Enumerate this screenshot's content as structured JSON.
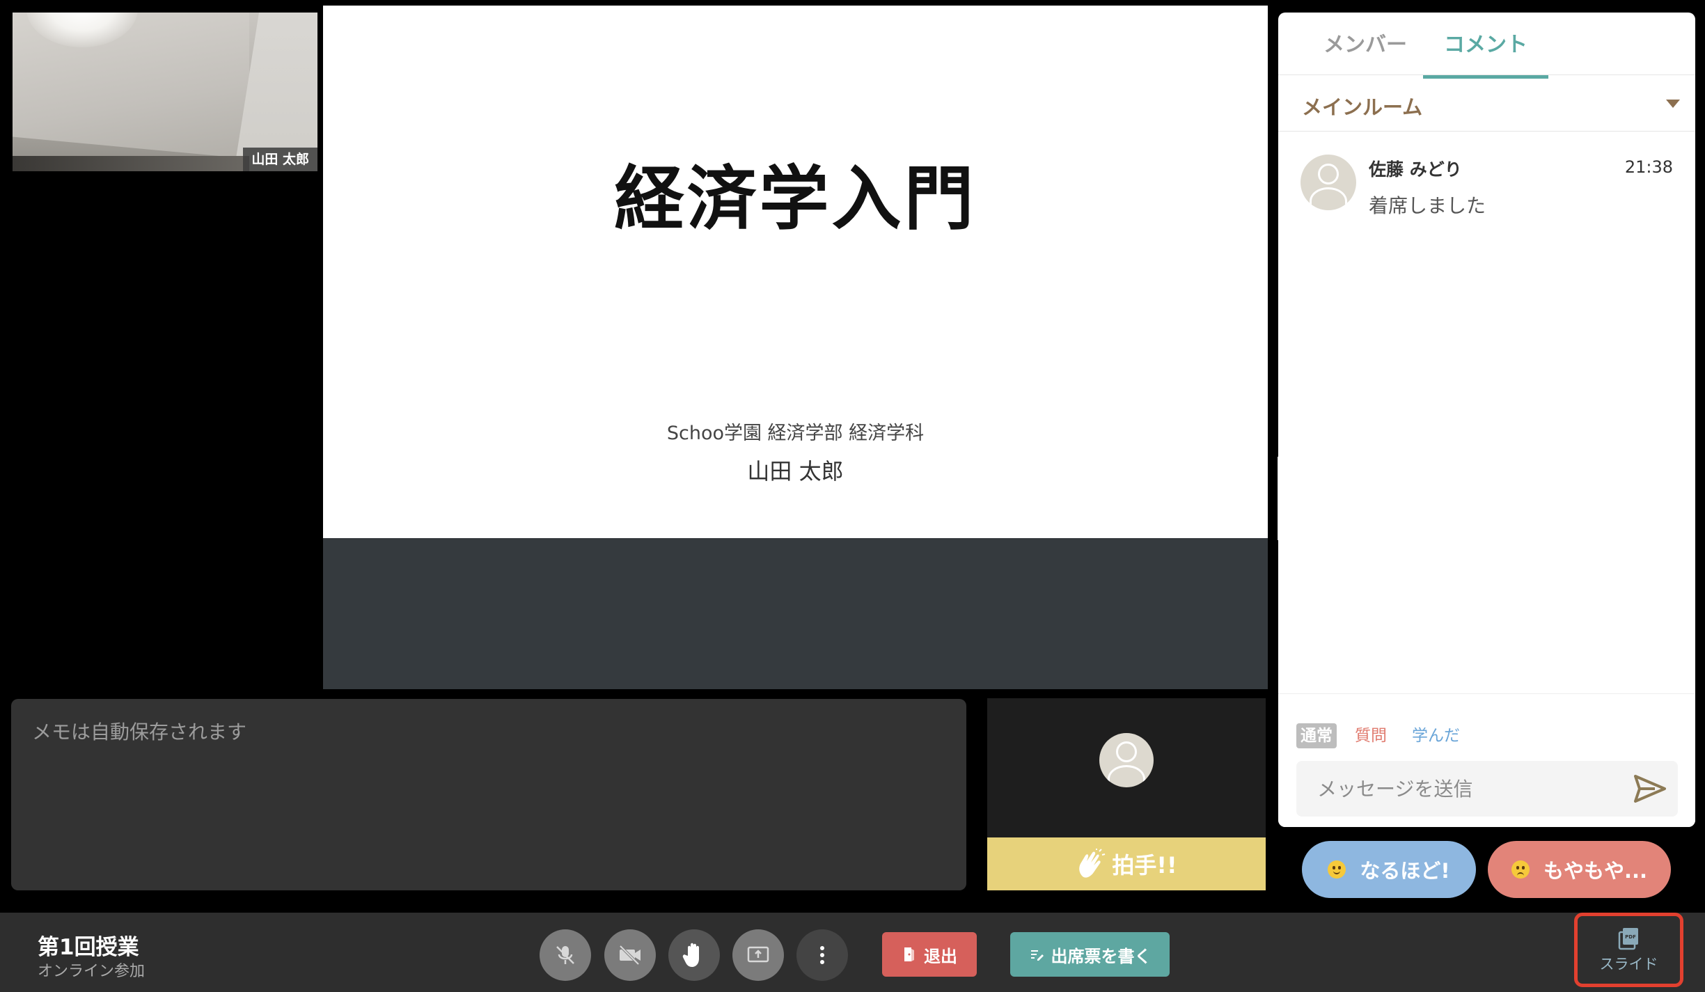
{
  "self_video": {
    "name_tag": "山田 太郎"
  },
  "slide": {
    "title": "経済学入門",
    "organization": "Schoo学園 経済学部 経済学科",
    "presenter": "山田 太郎"
  },
  "side_panel": {
    "tabs": [
      {
        "label": "メンバー",
        "active": false
      },
      {
        "label": "コメント",
        "active": true
      }
    ],
    "room": {
      "selected": "メインルーム"
    },
    "comments": [
      {
        "author": "佐藤 みどり",
        "time": "21:38",
        "text": "着席しました"
      }
    ],
    "composer": {
      "types": [
        "通常",
        "質問",
        "学んだ"
      ],
      "selected_type": "通常",
      "placeholder": "メッセージを送信"
    }
  },
  "reactions": {
    "naruhodo": "なるほど!",
    "moyamoya": "もやもや..."
  },
  "memo": {
    "placeholder": "メモは自動保存されます"
  },
  "participant": {
    "applause_label": "拍手!!"
  },
  "bottom_bar": {
    "class_title": "第1回授業",
    "class_subtitle": "オンライン参加",
    "leave_label": "退出",
    "attendance_label": "出席票を書く",
    "slide_label": "スライド"
  },
  "colors": {
    "accent_teal": "#5aa9a3",
    "leave_red": "#d6605b",
    "applause_yellow": "#e7d27b",
    "highlight_red": "#e2402f"
  }
}
